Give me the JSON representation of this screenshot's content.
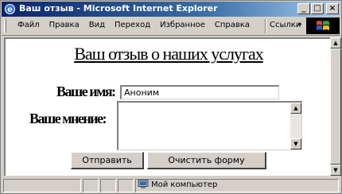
{
  "window": {
    "title": "Ваш отзыв - Microsoft Internet Explorer",
    "minimize_label": "_",
    "maximize_label": "□",
    "close_label": "×"
  },
  "menu": {
    "items": [
      "Файл",
      "Правка",
      "Вид",
      "Переход",
      "Избранное",
      "Справка"
    ],
    "links_label": "Ссылки",
    "chevron": "»"
  },
  "page": {
    "heading": "Ваш отзыв о наших услугах",
    "name_label": "Ваше имя:",
    "name_value": "Аноним",
    "opinion_label": "Ваше мнение:",
    "opinion_value": "",
    "submit_label": "Отправить",
    "reset_label": "Очистить форму"
  },
  "status": {
    "zone_label": "Мой компьютер",
    "zone_icon": "computer-icon"
  }
}
